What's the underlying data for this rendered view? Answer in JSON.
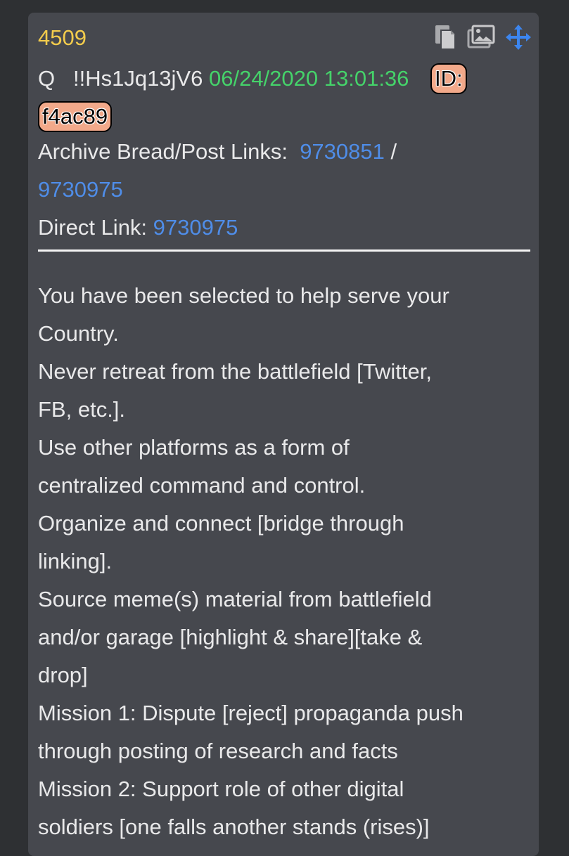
{
  "post": {
    "number": "4509",
    "author": "Q",
    "tripcode": "!!Hs1Jq13jV6",
    "datetime": "06/24/2020 13:01:36",
    "id_label": "ID:",
    "id_value": "f4ac89",
    "archive_label": "Archive Bread/Post Links:",
    "archive_link_1": "9730851",
    "archive_separator": "/",
    "archive_link_2": "9730975",
    "direct_label": "Direct Link:",
    "direct_link": "9730975"
  },
  "toolbar": {
    "icons": [
      "copy-icon",
      "images-icon",
      "move-icon"
    ]
  },
  "body_lines": [
    "You have been selected to help serve your",
    "Country.",
    "Never retreat from the battlefield [Twitter,",
    "FB, etc.].",
    "Use other platforms as a form of",
    "centralized command and control.",
    "Organize and connect [bridge through",
    "linking].",
    "Source meme(s) material from battlefield",
    "and/or garage [highlight & share][take &",
    "drop]",
    "Mission 1: Dispute [reject] propaganda push",
    "through posting of research and facts",
    "Mission 2: Support role of other digital",
    "soldiers [one falls another stands (rises)]"
  ],
  "colors": {
    "background": "#2e3033",
    "card": "#46484e",
    "post_number": "#f3cc4c",
    "datetime": "#45d36a",
    "link": "#4f8de8",
    "id_badge": "#f2a98a"
  }
}
